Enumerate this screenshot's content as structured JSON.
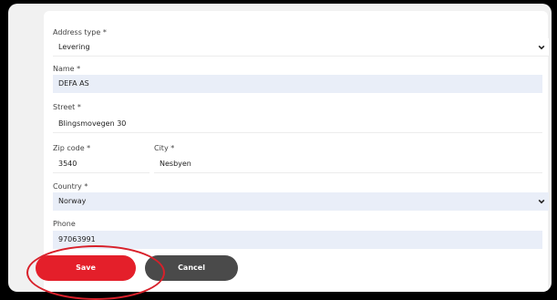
{
  "form": {
    "address_type": {
      "label": "Address type *",
      "value": "Levering"
    },
    "name": {
      "label": "Name *",
      "value": "DEFA AS"
    },
    "street": {
      "label": "Street *",
      "value": "Blingsmovegen 30"
    },
    "zip": {
      "label": "Zip code *",
      "value": "3540"
    },
    "city": {
      "label": "City *",
      "value": "Nesbyen"
    },
    "country": {
      "label": "Country *",
      "value": "Norway"
    },
    "phone": {
      "label": "Phone",
      "value": "97063991"
    }
  },
  "buttons": {
    "save": "Save",
    "cancel": "Cancel"
  },
  "icons": {
    "select_arrow": "chevron-down-icon"
  },
  "colors": {
    "save": "#e41f2a",
    "cancel": "#4a4a4a",
    "highlight_ring": "#d8202a",
    "field_bg": "#e9eef8"
  }
}
